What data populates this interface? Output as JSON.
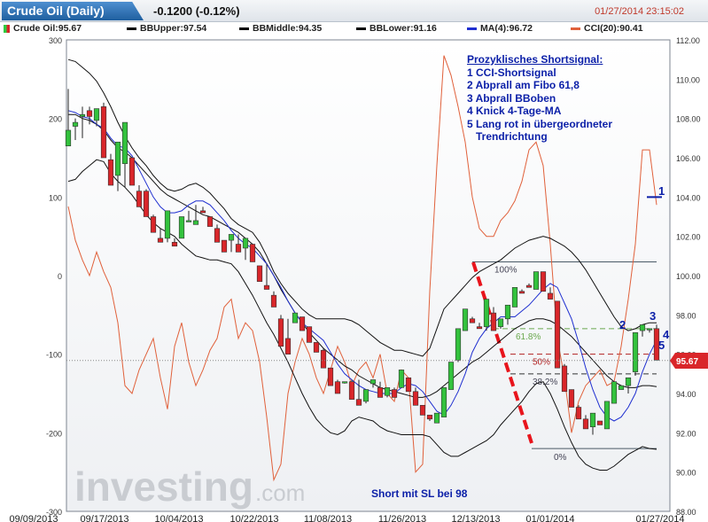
{
  "header": {
    "title": "Crude Oil (Daily)",
    "change": "-0.1200 (-0.12%)",
    "timestamp": "01/27/2014 23:15:02"
  },
  "legend": [
    {
      "label": "Crude Oil:95.67",
      "color": "#2ecc40"
    },
    {
      "label": "BBUpper:97.54",
      "color": "#000000"
    },
    {
      "label": "BBMiddle:94.35",
      "color": "#000000"
    },
    {
      "label": "BBLower:91.16",
      "color": "#000000"
    },
    {
      "label": "MA(4):96.72",
      "color": "#1f2fd0"
    },
    {
      "label": "CCI(20):90.41",
      "color": "#e0603a"
    }
  ],
  "annotations": {
    "heading": "Prozyklisches Shortsignal:",
    "lines": [
      "1 CCI-Shortsignal",
      "2 Abprall am Fibo 61,8",
      "3 Abprall BBoben",
      "4 Knick 4-Tage-MA",
      "5 Lang rot in übergeordneter",
      "   Trendrichtung"
    ],
    "stop_note": "Short mit SL bei 98",
    "markers": [
      "1",
      "2",
      "3",
      "4",
      "5"
    ]
  },
  "watermark": {
    "brand": "investing",
    "suffix": ".com"
  },
  "price_tag": "95.67",
  "chart_data": {
    "type": "candlestick",
    "title": "Crude Oil (Daily)",
    "x_tick_labels": [
      "09/09/2013",
      "09/17/2013",
      "10/04/2013",
      "10/22/2013",
      "11/08/2013",
      "11/26/2013",
      "12/13/2013",
      "01/01/2014",
      "01/27/2014"
    ],
    "y_right": {
      "label": "price",
      "range": [
        88,
        112
      ],
      "ticks": [
        88,
        90,
        92,
        94,
        96,
        98,
        100,
        102,
        104,
        106,
        108,
        110,
        112
      ]
    },
    "y_left": {
      "label": "CCI(20)",
      "range": [
        -300,
        300
      ],
      "ticks": [
        -300,
        -200,
        -100,
        0,
        100,
        200,
        300
      ]
    },
    "fib_levels": [
      {
        "label": "100%",
        "price": 100.7
      },
      {
        "label": "61.8%",
        "price": 97.3
      },
      {
        "label": "50%",
        "price": 96.0
      },
      {
        "label": "38.2%",
        "price": 95.0
      },
      {
        "label": "0%",
        "price": 91.2
      }
    ],
    "reference_lines": [
      {
        "name": "current-level",
        "value": -108,
        "axis": "cci",
        "style": "dotted"
      },
      {
        "name": "cci-short-signal",
        "value": 104.0,
        "axis": "price"
      }
    ],
    "ohlc": [
      [
        106.6,
        108.8,
        107.4,
        109.5
      ],
      [
        107.6,
        108.0,
        107.8,
        106.9
      ],
      [
        108.1,
        108.6,
        108.2,
        107.0
      ],
      [
        108.4,
        108.6,
        108.1,
        107.7
      ],
      [
        107.9,
        107.9,
        108.5,
        107.6
      ],
      [
        108.6,
        108.3,
        106.0,
        108.8
      ],
      [
        105.9,
        106.2,
        104.6,
        105.2
      ],
      [
        105.1,
        104.6,
        106.8,
        104.3
      ],
      [
        105.7,
        105.9,
        107.8,
        104.5
      ],
      [
        106.0,
        105.9,
        104.6,
        105.2
      ],
      [
        104.3,
        104.6,
        103.5,
        104.4
      ],
      [
        104.3,
        104.4,
        103.0,
        103.5
      ],
      [
        103.0,
        103.1,
        102.2,
        102.7
      ],
      [
        101.9,
        102.4,
        101.7,
        102.2
      ],
      [
        101.9,
        102.2,
        103.3,
        101.7
      ],
      [
        101.7,
        101.6,
        101.5,
        101.9
      ],
      [
        101.9,
        102.2,
        103.0,
        102.4
      ],
      [
        102.8,
        103.0,
        102.8,
        103.3
      ],
      [
        102.6,
        102.9,
        102.8,
        103.6
      ],
      [
        103.3,
        103.5,
        103.2,
        103.4
      ],
      [
        103.0,
        102.8,
        102.5,
        102.7
      ],
      [
        102.4,
        102.5,
        101.7,
        102.6
      ],
      [
        101.8,
        101.6,
        101.2,
        101.6
      ],
      [
        101.8,
        102.0,
        102.1,
        101.2
      ],
      [
        101.6,
        101.4,
        101.2,
        102.1
      ],
      [
        101.4,
        101.5,
        101.9,
        100.8
      ],
      [
        101.6,
        101.3,
        100.7,
        101.4
      ],
      [
        100.5,
        100.3,
        99.7,
        100.4
      ],
      [
        99.5,
        99.5,
        99.3,
        100.6
      ],
      [
        99.0,
        98.9,
        98.4,
        99.2
      ],
      [
        97.8,
        97.4,
        96.4,
        98.0
      ],
      [
        96.8,
        97.2,
        96.0,
        97.8
      ],
      [
        97.6,
        97.7,
        98.1,
        97.9
      ],
      [
        97.9,
        97.9,
        97.2,
        97.3
      ],
      [
        97.4,
        97.0,
        96.6,
        96.7
      ],
      [
        96.6,
        96.1,
        96.1,
        96.6
      ],
      [
        96.2,
        95.8,
        95.3,
        96.3
      ],
      [
        95.3,
        95.1,
        94.4,
        95.1
      ],
      [
        94.6,
        94.4,
        94.0,
        94.7
      ],
      [
        94.6,
        94.5,
        94.6,
        94.5
      ],
      [
        94.6,
        94.4,
        93.7,
        94.7
      ],
      [
        93.7,
        93.6,
        93.4,
        94.7
      ],
      [
        93.6,
        93.5,
        94.2,
        93.8
      ],
      [
        94.5,
        94.6,
        94.7,
        94.3
      ],
      [
        94.3,
        94.2,
        93.8,
        94.6
      ],
      [
        93.9,
        93.8,
        94.3,
        93.9
      ],
      [
        94.2,
        94.1,
        93.8,
        94.3
      ],
      [
        94.3,
        94.5,
        95.2,
        94.4
      ],
      [
        94.8,
        94.8,
        94.1,
        94.5
      ],
      [
        94.1,
        94.2,
        93.4,
        94.3
      ],
      [
        93.4,
        93.4,
        92.9,
        93.0
      ],
      [
        92.9,
        92.6,
        92.7,
        92.7
      ],
      [
        92.5,
        92.5,
        93.0,
        92.5
      ],
      [
        92.8,
        92.8,
        94.3,
        92.8
      ],
      [
        94.2,
        94.4,
        95.6,
        94.3
      ],
      [
        95.7,
        95.6,
        97.3,
        95.6
      ],
      [
        97.2,
        97.2,
        98.3,
        97.4
      ],
      [
        97.8,
        97.9,
        97.6,
        97.9
      ],
      [
        97.4,
        97.6,
        97.3,
        97.5
      ],
      [
        97.4,
        97.2,
        98.8,
        97.2
      ],
      [
        98.1,
        98.4,
        97.2,
        98.3
      ],
      [
        97.4,
        97.8,
        97.8,
        97.3
      ],
      [
        97.8,
        97.5,
        98.5,
        97.6
      ],
      [
        98.4,
        98.5,
        99.4,
        98.5
      ],
      [
        99.2,
        99.1,
        99.1,
        99.3
      ],
      [
        99.5,
        99.4,
        99.4,
        99.6
      ],
      [
        99.3,
        99.3,
        100.2,
        99.5
      ],
      [
        100.2,
        100.2,
        99.2,
        100.1
      ],
      [
        99.1,
        99.2,
        98.8,
        99.4
      ],
      [
        98.7,
        98.2,
        95.3,
        98.5
      ],
      [
        95.4,
        95.5,
        94.1,
        95.2
      ],
      [
        94.2,
        94.1,
        93.3,
        94.0
      ],
      [
        93.3,
        93.4,
        92.7,
        93.4
      ],
      [
        92.7,
        92.9,
        92.2,
        92.6
      ],
      [
        92.3,
        91.9,
        93.0,
        92.2
      ],
      [
        92.6,
        92.6,
        92.4,
        92.5
      ],
      [
        92.2,
        92.3,
        93.6,
        92.4
      ],
      [
        93.5,
        93.7,
        94.6,
        93.8
      ],
      [
        94.2,
        94.4,
        94.4,
        94.2
      ],
      [
        94.4,
        94.3,
        94.8,
        94.0
      ],
      [
        95.1,
        94.9,
        97.1,
        94.9
      ],
      [
        97.2,
        97.1,
        97.5,
        96.9
      ],
      [
        97.3,
        97.3,
        97.3,
        97.1
      ],
      [
        97.3,
        97.3,
        95.7,
        97.5
      ]
    ],
    "bb_upper": [
      111.0,
      110.9,
      110.6,
      110.3,
      109.9,
      109.3,
      108.6,
      107.8,
      107.1,
      106.5,
      106.0,
      105.6,
      105.1,
      104.7,
      104.4,
      104.3,
      104.4,
      104.6,
      104.7,
      104.5,
      104.2,
      103.8,
      103.4,
      102.9,
      102.6,
      102.4,
      102.2,
      101.7,
      101.0,
      100.2,
      99.6,
      99.1,
      98.7,
      98.3,
      98.0,
      97.8,
      97.8,
      97.8,
      97.8,
      97.8,
      97.7,
      97.5,
      97.2,
      96.9,
      96.6,
      96.4,
      96.2,
      96.2,
      96.1,
      96.0,
      95.9,
      96.3,
      97.3,
      98.3,
      98.7,
      99.1,
      99.5,
      99.9,
      100.2,
      100.4,
      100.6,
      100.8,
      101.1,
      101.4,
      101.6,
      101.8,
      101.9,
      102.0,
      101.9,
      101.7,
      101.5,
      101.2,
      100.8,
      100.3,
      99.7,
      99.1,
      98.5,
      97.9,
      97.4,
      97.2,
      97.3,
      97.5,
      97.6,
      97.6
    ],
    "bb_middle": [
      108.2,
      108.2,
      108.0,
      107.9,
      107.7,
      107.4,
      106.9,
      106.5,
      106.3,
      106.0,
      105.6,
      105.2,
      104.8,
      104.4,
      104.1,
      103.9,
      103.7,
      103.5,
      103.3,
      103.1,
      103.0,
      102.8,
      102.6,
      102.4,
      102.2,
      101.9,
      101.6,
      101.2,
      100.6,
      100.0,
      99.3,
      98.7,
      98.1,
      97.6,
      97.1,
      96.7,
      96.3,
      96.0,
      95.7,
      95.4,
      95.2,
      94.9,
      94.7,
      94.5,
      94.3,
      94.2,
      94.1,
      94.0,
      93.9,
      93.8,
      93.8,
      93.9,
      94.1,
      94.4,
      94.7,
      95.0,
      95.3,
      95.6,
      95.8,
      96.1,
      96.4,
      96.7,
      97.0,
      97.3,
      97.5,
      97.7,
      97.8,
      97.8,
      97.7,
      97.5,
      97.2,
      96.9,
      96.5,
      96.1,
      95.7,
      95.3,
      94.9,
      94.6,
      94.4,
      94.3,
      94.3,
      94.4,
      94.4,
      94.35
    ],
    "bb_lower": [
      104.8,
      104.9,
      105.3,
      105.6,
      105.9,
      105.8,
      105.2,
      104.8,
      104.5,
      104.1,
      103.6,
      103.1,
      102.7,
      102.4,
      102.2,
      102.0,
      101.6,
      101.3,
      101.0,
      100.9,
      100.8,
      100.8,
      100.7,
      100.6,
      100.2,
      99.6,
      99.0,
      98.3,
      97.6,
      97.0,
      96.3,
      95.6,
      94.8,
      94.0,
      93.3,
      92.7,
      92.3,
      92.0,
      91.9,
      92.1,
      92.6,
      92.8,
      92.7,
      92.6,
      92.3,
      92.1,
      92.0,
      91.9,
      91.9,
      91.9,
      91.9,
      91.8,
      91.4,
      91.0,
      90.8,
      90.8,
      91.0,
      91.2,
      91.4,
      91.6,
      91.9,
      92.4,
      92.8,
      93.2,
      93.6,
      94.1,
      94.5,
      94.6,
      94.0,
      93.2,
      92.3,
      91.5,
      90.8,
      90.4,
      90.2,
      90.1,
      90.1,
      90.3,
      90.6,
      90.9,
      91.1,
      91.3,
      91.2,
      91.16
    ],
    "ma4": [
      108.4,
      108.3,
      108.1,
      108.0,
      107.7,
      107.5,
      107.0,
      106.6,
      106.5,
      106.1,
      105.4,
      104.7,
      104.0,
      103.5,
      103.2,
      103.2,
      103.3,
      103.6,
      103.8,
      103.8,
      103.6,
      103.2,
      102.8,
      102.3,
      101.9,
      101.6,
      101.4,
      101.0,
      100.6,
      100.0,
      99.4,
      98.7,
      98.1,
      97.6,
      97.3,
      97.0,
      96.7,
      96.1,
      95.5,
      95.0,
      94.7,
      94.4,
      94.2,
      94.1,
      94.0,
      94.0,
      94.0,
      94.3,
      94.5,
      94.4,
      94.1,
      93.6,
      93.1,
      92.9,
      93.4,
      94.1,
      95.0,
      96.1,
      96.8,
      97.3,
      97.6,
      97.9,
      97.9,
      97.9,
      98.2,
      98.5,
      98.9,
      99.3,
      99.6,
      99.4,
      98.6,
      97.8,
      96.6,
      95.3,
      94.2,
      93.3,
      92.8,
      92.6,
      92.8,
      93.3,
      94.0,
      95.1,
      96.0,
      96.72
    ],
    "cci20": [
      88,
      45,
      20,
      0,
      30,
      5,
      -15,
      -60,
      -140,
      -150,
      -120,
      -100,
      -80,
      -130,
      -170,
      -90,
      -60,
      -110,
      -140,
      -120,
      -95,
      -80,
      -40,
      -30,
      -80,
      -60,
      -70,
      -110,
      -180,
      -260,
      -240,
      -150,
      -110,
      -80,
      -100,
      -130,
      -150,
      -120,
      -90,
      -110,
      -140,
      -120,
      -110,
      -130,
      -100,
      -150,
      -160,
      -120,
      -130,
      -250,
      -240,
      -20,
      140,
      280,
      255,
      215,
      170,
      100,
      60,
      50,
      50,
      70,
      80,
      95,
      120,
      160,
      170,
      140,
      40,
      -80,
      -130,
      -200,
      -160,
      -140,
      -130,
      -120,
      -140,
      -135,
      -90,
      -30,
      40,
      160,
      160,
      90
    ]
  }
}
